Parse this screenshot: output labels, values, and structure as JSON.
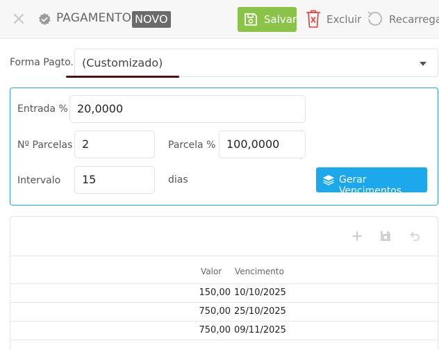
{
  "header": {
    "title": "PAGAMENTO",
    "badge": "NOVO",
    "save_label": "Salvar",
    "delete_label": "Excluir",
    "reload_label": "Recarregar"
  },
  "forma": {
    "label": "Forma Pagto.",
    "value": "(Customizado)"
  },
  "config": {
    "entrada_label": "Entrada %",
    "entrada_value": "20,0000",
    "parcelas_label": "Nº Parcelas",
    "parcelas_value": "2",
    "parcela_pct_label": "Parcela %",
    "parcela_pct_value": "100,0000",
    "intervalo_label": "Intervalo",
    "intervalo_value": "15",
    "dias_label": "dias",
    "gerar_label": "Gerar Vencimentos"
  },
  "table": {
    "columns": [
      "Valor",
      "Vencimento"
    ],
    "rows": [
      {
        "valor": "150,00",
        "vencimento": "10/10/2025"
      },
      {
        "valor": "750,00",
        "vencimento": "25/10/2025"
      },
      {
        "valor": "750,00",
        "vencimento": "09/11/2025"
      }
    ]
  },
  "colors": {
    "accent": "#1ea8ec",
    "save": "#8bc34a",
    "delete_icon": "#e53935",
    "panel_border": "#29a3d8"
  },
  "icons": [
    "close-icon",
    "check-badge-icon",
    "save-icon",
    "trash-icon",
    "reload-icon",
    "layers-icon",
    "plus-icon",
    "disk-icon",
    "undo-icon"
  ]
}
